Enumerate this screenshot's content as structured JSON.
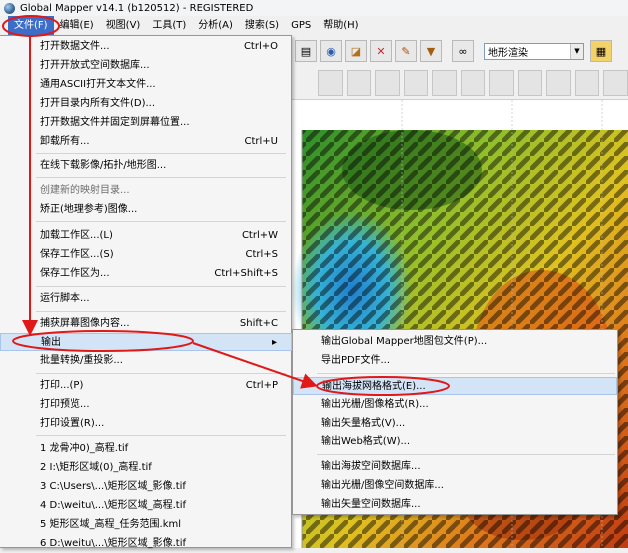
{
  "window": {
    "title": "Global Mapper v14.1 (b120512) - REGISTERED"
  },
  "menubar": {
    "items": [
      "文件(F)",
      "编辑(E)",
      "视图(V)",
      "工具(T)",
      "分析(A)",
      "搜索(S)",
      "GPS",
      "帮助(H)"
    ]
  },
  "toolbar": {
    "combo_value": "地形渲染"
  },
  "file_menu": {
    "items": [
      {
        "label": "打开数据文件...",
        "shortcut": "Ctrl+O"
      },
      {
        "label": "打开开放式空间数据库...",
        "shortcut": ""
      },
      {
        "label": "通用ASCII打开文本文件...",
        "shortcut": ""
      },
      {
        "label": "打开目录内所有文件(D)...",
        "shortcut": ""
      },
      {
        "label": "打开数据文件并固定到屏幕位置...",
        "shortcut": ""
      },
      {
        "label": "卸载所有...",
        "shortcut": "Ctrl+U"
      },
      {
        "label": "在线下载影像/拓扑/地形图...",
        "shortcut": ""
      },
      {
        "label": "创建新的映射目录...",
        "shortcut": ""
      },
      {
        "label": "矫正(地理参考)图像...",
        "shortcut": ""
      },
      {
        "label": "加载工作区...(L)",
        "shortcut": "Ctrl+W"
      },
      {
        "label": "保存工作区...(S)",
        "shortcut": "Ctrl+S"
      },
      {
        "label": "保存工作区为...",
        "shortcut": "Ctrl+Shift+S"
      },
      {
        "label": "运行脚本...",
        "shortcut": ""
      },
      {
        "label": "捕获屏幕图像内容...",
        "shortcut": "Shift+C"
      },
      {
        "label": "输出",
        "shortcut": ""
      },
      {
        "label": "批量转换/重投影...",
        "shortcut": ""
      },
      {
        "label": "打印...(P)",
        "shortcut": "Ctrl+P"
      },
      {
        "label": "打印预览...",
        "shortcut": ""
      },
      {
        "label": "打印设置(R)...",
        "shortcut": ""
      },
      {
        "label": "1 龙骨冲0)_高程.tif",
        "shortcut": ""
      },
      {
        "label": "2 I:\\矩形区域(0)_高程.tif",
        "shortcut": ""
      },
      {
        "label": "3 C:\\Users\\...\\矩形区域_影像.tif",
        "shortcut": ""
      },
      {
        "label": "4 D:\\weitu\\...\\矩形区域_高程.tif",
        "shortcut": ""
      },
      {
        "label": "5 矩形区域_高程_任务范围.kml",
        "shortcut": ""
      },
      {
        "label": "6 D:\\weitu\\...\\矩形区域_影像.tif",
        "shortcut": ""
      }
    ]
  },
  "export_submenu": {
    "items": [
      "输出Global Mapper地图包文件(P)...",
      "导出PDF文件...",
      "输出海拔网格格式(E)...",
      "输出光栅/图像格式(R)...",
      "输出矢量格式(V)...",
      "输出Web格式(W)...",
      "输出海拔空间数据库...",
      "输出光栅/图像空间数据库...",
      "输出矢量空间数据库..."
    ]
  },
  "colors": {
    "menu_active": "#3c6ec9",
    "annotation": "#e01818",
    "highlight": "#d3e4f7"
  }
}
